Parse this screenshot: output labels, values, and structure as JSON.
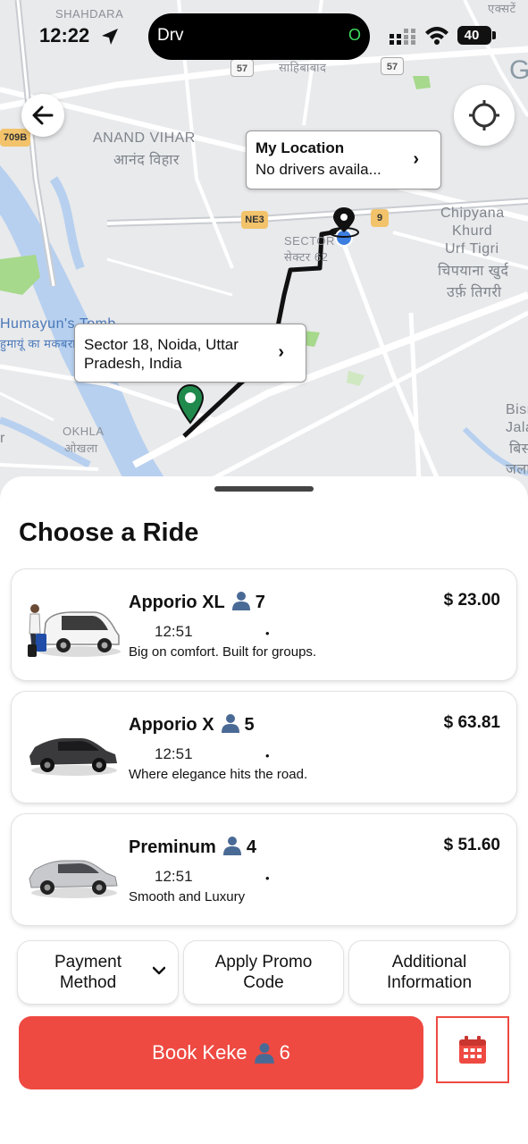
{
  "status_bar": {
    "time": "12:22",
    "island_label": "Drv",
    "island_indicator": "O",
    "battery": "40"
  },
  "map": {
    "labels": {
      "shahdara": "SHAHDARA",
      "top_right_hindi": "एक्सटें",
      "sahibabad": "साहिबाबाद",
      "anand_vihar": "ANAND VIHAR",
      "anand_vihar_hindi": "आनंद विहार",
      "sector": "SECTOR",
      "sector_hindi": "सेक्टर 62",
      "chipyana": "Chipyana",
      "khurd": "Khurd",
      "urf_tigri": "Urf Tigri",
      "chipyana_hindi": "चिपयाना खुर्द",
      "tigri_hindi": "उर्फ़ तिगरी",
      "humayun": "Humayun's Tomb",
      "humayun_hindi": "हुमायूं का मकबरा",
      "okhla": "OKHLA",
      "okhla_hindi": "ओखला",
      "bisr": "Bisr",
      "jala": "Jala",
      "bisr_hindi": "बिस",
      "jala_hindi": "जला",
      "g": "G",
      "r": "r"
    },
    "shields": {
      "nh709b": "709B",
      "nh57_left": "57",
      "nh57_right": "57",
      "ne3": "NE3",
      "nh9": "9"
    },
    "my_location": {
      "title": "My Location",
      "subtitle": "No drivers availa..."
    },
    "destination": {
      "line1": "Sector 18, Noida, Uttar",
      "line2": "Pradesh, India"
    }
  },
  "sheet": {
    "title": "Choose a Ride",
    "rides": [
      {
        "name": "Apporio XL",
        "seats": "7",
        "price": "$ 23.00",
        "eta": "12:51",
        "dot": "•",
        "description": "Big on comfort. Built for groups."
      },
      {
        "name": "Apporio X",
        "seats": "5",
        "price": "$ 63.81",
        "eta": "12:51",
        "dot": "•",
        "description": "Where elegance hits the road."
      },
      {
        "name": "Preminum",
        "seats": "4",
        "price": "$ 51.60",
        "eta": "12:51",
        "dot": "•",
        "description": "Smooth and Luxury"
      }
    ],
    "options": {
      "payment_line1": "Payment",
      "payment_line2": "Method",
      "promo_line1": "Apply Promo",
      "promo_line2": "Code",
      "info_line1": "Additional",
      "info_line2": "Information"
    },
    "book": {
      "label": "Book Keke",
      "seats": "6"
    }
  },
  "colors": {
    "accent": "#ee4a42",
    "route": "#111111",
    "destination_pin": "#1f8a4c",
    "user_dot": "#3d7fe0"
  }
}
